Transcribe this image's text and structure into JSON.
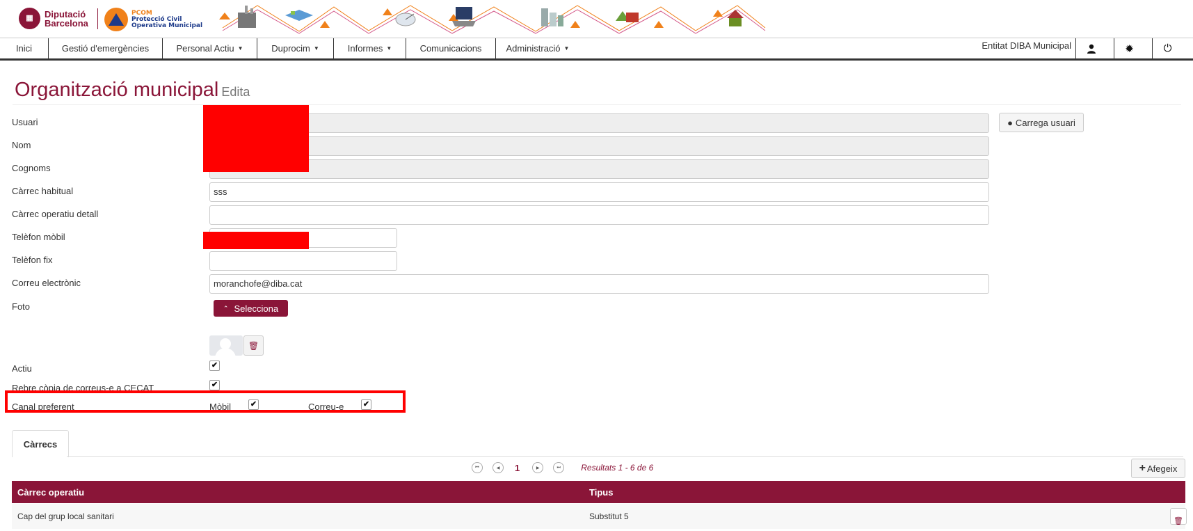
{
  "header": {
    "diba_logo_line1": "Diputació",
    "diba_logo_line2": "Barcelona",
    "pcom_line1": "PCOM",
    "pcom_line2": "Protecció Civil",
    "pcom_line3": "Operativa Municipal"
  },
  "nav": {
    "items": [
      {
        "label": "Inici"
      },
      {
        "label": "Gestió d'emergències"
      },
      {
        "label": "Personal Actiu"
      },
      {
        "label": "Duprocim"
      },
      {
        "label": "Informes"
      },
      {
        "label": "Comunicacions"
      },
      {
        "label": "Administració"
      }
    ],
    "entity": "Entitat DIBA Municipal",
    "icons": [
      "user-icon",
      "gear-icon",
      "power-icon"
    ]
  },
  "page": {
    "title": "Organització municipal",
    "subtitle": "Edita"
  },
  "form": {
    "usuari_label": "Usuari",
    "nom_label": "Nom",
    "cognoms_label": "Cognoms",
    "carrec_habitual_label": "Càrrec habitual",
    "carrec_habitual_value": "sss",
    "carrec_operatiu_label": "Càrrec operatiu detall",
    "telefon_mobil_label": "Telèfon mòbil",
    "telefon_fix_label": "Telèfon fix",
    "correu_label": "Correu electrònic",
    "correu_value": "moranchofe@diba.cat",
    "foto_label": "Foto",
    "selecciona_label": "Selecciona",
    "carrega_usuari_label": "Carrega usuari",
    "actiu_label": "Actiu",
    "actiu_checked": true,
    "copia_label": "Rebre còpia de correus-e a CECAT",
    "copia_checked": true,
    "canal_label": "Canal preferent",
    "mobil_label": "Mòbil",
    "mobil_checked": true,
    "correu_e_label": "Correu-e",
    "correu_e_checked": true
  },
  "tabs": [
    {
      "label": "Càrrecs"
    }
  ],
  "pagination": {
    "current_page": "1",
    "results": "Resultats 1 - 6 de 6"
  },
  "add_button_label": "Afegeix",
  "table": {
    "columns": [
      "Càrrec operatiu",
      "Tipus"
    ],
    "rows": [
      {
        "carrec": "Cap del grup local sanitari",
        "tipus": "Substitut 5"
      }
    ]
  }
}
